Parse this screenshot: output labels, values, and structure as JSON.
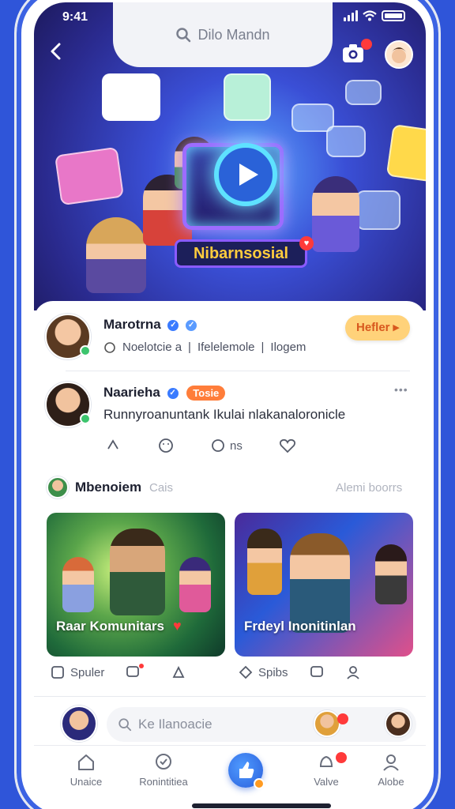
{
  "status": {
    "time": "9:41"
  },
  "header": {
    "search_text": "Dilo Mandn",
    "brand": "Nibarnsosial"
  },
  "post1": {
    "author": "Marotrna",
    "meta": [
      "Noelotcie a",
      "Ifelelemole",
      "Ilogem"
    ],
    "follow_label": "Hefler ▸"
  },
  "post2": {
    "author": "Naarieha",
    "badge": "Tosie",
    "more": "•••",
    "text": "Runnyroanuntank Ikulai nlakanaloronicle",
    "actions": [
      "",
      "",
      "ns",
      ""
    ]
  },
  "section": {
    "title": "Mbenoiem",
    "subtitle": "Cais",
    "see_all": "Alemi boorrs"
  },
  "cards": [
    {
      "caption": "Raar Komunitars",
      "actions": [
        "Spuler",
        "",
        ""
      ]
    },
    {
      "caption": "Frdeyl Inonitinlan",
      "actions": [
        "Spibs",
        "",
        ""
      ]
    }
  ],
  "composer": {
    "placeholder": "Ke Ilanoacie"
  },
  "tabs": [
    "Unaice",
    "Ronintitiea",
    "",
    "Valve",
    "Alobe"
  ],
  "colors": {
    "primary": "#2f55d9",
    "accent": "#ff7d3a",
    "follow_bg": "#ffd27a"
  }
}
